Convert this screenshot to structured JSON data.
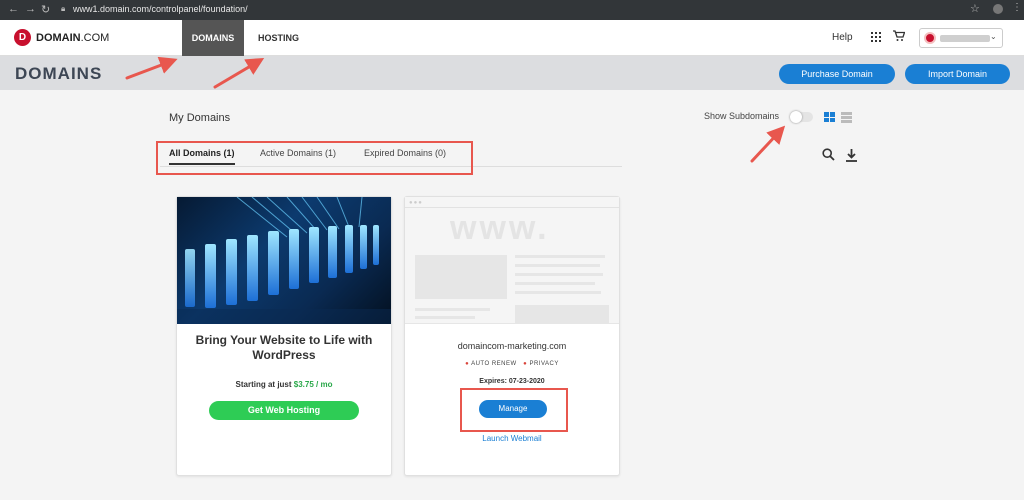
{
  "browser": {
    "url": "www1.domain.com/controlpanel/foundation/"
  },
  "nav": {
    "logo_letter": "D",
    "logo_brand": "DOMAIN",
    "logo_suffix": ".COM",
    "tabs": [
      {
        "label": "DOMAINS",
        "active": true
      },
      {
        "label": "HOSTING",
        "active": false
      }
    ],
    "help": "Help"
  },
  "header": {
    "title": "DOMAINS",
    "purchase_label": "Purchase Domain",
    "import_label": "Import Domain"
  },
  "content": {
    "heading": "My Domains",
    "show_subdomains": "Show Subdomains",
    "show_subdomains_on": false,
    "view_mode": "grid",
    "filters": [
      {
        "label": "All Domains (1)",
        "active": true
      },
      {
        "label": "Active Domains (1)",
        "active": false
      },
      {
        "label": "Expired Domains (0)",
        "active": false
      }
    ]
  },
  "promo_card": {
    "title": "Bring Your Website to Life with WordPress",
    "price_prefix": "Starting at just ",
    "price": "$3.75 / mo",
    "button": "Get Web Hosting"
  },
  "domain_card": {
    "preview_text": "www.",
    "domain": "domaincom-marketing.com",
    "badge1": "AUTO RENEW",
    "badge2": "PRIVACY",
    "expires": "Expires: 07-23-2020",
    "manage": "Manage",
    "webmail": "Launch Webmail"
  },
  "colors": {
    "brand_red": "#c8102e",
    "primary_blue": "#1a7fd4",
    "success_green": "#2ecc55",
    "annotation_red": "#e8574e"
  }
}
